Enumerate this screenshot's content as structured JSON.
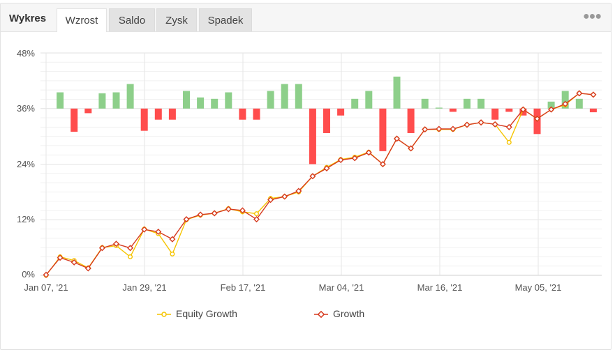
{
  "tabs": {
    "title": "Wykres",
    "items": [
      {
        "label": "Wzrost",
        "active": true
      },
      {
        "label": "Saldo",
        "active": false
      },
      {
        "label": "Zysk",
        "active": false
      },
      {
        "label": "Spadek",
        "active": false
      }
    ],
    "more_icon": "more-horizontal-icon"
  },
  "colors": {
    "equity": "#f5c400",
    "growth": "#d63a1f",
    "bar_positive": "#8dcf8a",
    "bar_negative": "#ff4d4d"
  },
  "chart_data": {
    "type": "line",
    "title": "",
    "xlabel": "",
    "ylabel": "",
    "ylim": [
      0,
      48
    ],
    "y_ticks": [
      "0%",
      "12%",
      "24%",
      "36%",
      "48%"
    ],
    "x_ticks": [
      "Jan 07, '21",
      "Jan 29, '21",
      "Feb 17, '21",
      "Mar 04, '21",
      "Mar 16, '21",
      "May 05, '21"
    ],
    "legend": [
      "Equity Growth",
      "Growth"
    ],
    "legend_position": "bottom",
    "grid": true,
    "series": [
      {
        "name": "Equity Growth",
        "values": [
          0,
          4,
          3.2,
          1.6,
          6,
          6.4,
          4,
          10,
          9,
          4.6,
          12,
          13,
          13.4,
          14.4,
          13.7,
          13.3,
          16.6,
          17,
          18,
          21.4,
          23.3,
          25,
          25.5,
          26.6,
          24,
          29.5,
          27.4,
          31.5,
          31.5,
          31.5,
          32.5,
          33,
          32.6,
          28.7,
          35.8,
          33.8,
          35.8,
          36.8,
          39.3,
          39
        ]
      },
      {
        "name": "Growth",
        "values": [
          0.1,
          3.8,
          2.8,
          1.5,
          5.9,
          6.8,
          5.9,
          9.9,
          9.4,
          7.8,
          12.1,
          13.1,
          13.4,
          14.3,
          14,
          12.1,
          16.3,
          17,
          18.2,
          21.4,
          23.1,
          24.9,
          25.3,
          26.5,
          24,
          29.5,
          27.4,
          31.5,
          31.6,
          31.6,
          32.5,
          33,
          32.6,
          32,
          35.8,
          33.8,
          35.8,
          37,
          39.3,
          39
        ]
      },
      {
        "name": "",
        "bar": true,
        "values": [
          3.5,
          -5,
          -1,
          3.3,
          3.5,
          5.3,
          -4.8,
          -2.4,
          -2.4,
          3.8,
          2.4,
          2.1,
          3.5,
          -2.4,
          -2.4,
          3.8,
          5.3,
          5.3,
          -12,
          -5.3,
          -1.5,
          2.1,
          3.8,
          -9.2,
          6.9,
          -5.3,
          2.1,
          0.2,
          -0.7,
          2.1,
          2.1,
          -2.4,
          -0.7,
          -1.5,
          -5.5,
          1.5,
          3.8,
          2.1,
          -0.8
        ]
      }
    ]
  }
}
